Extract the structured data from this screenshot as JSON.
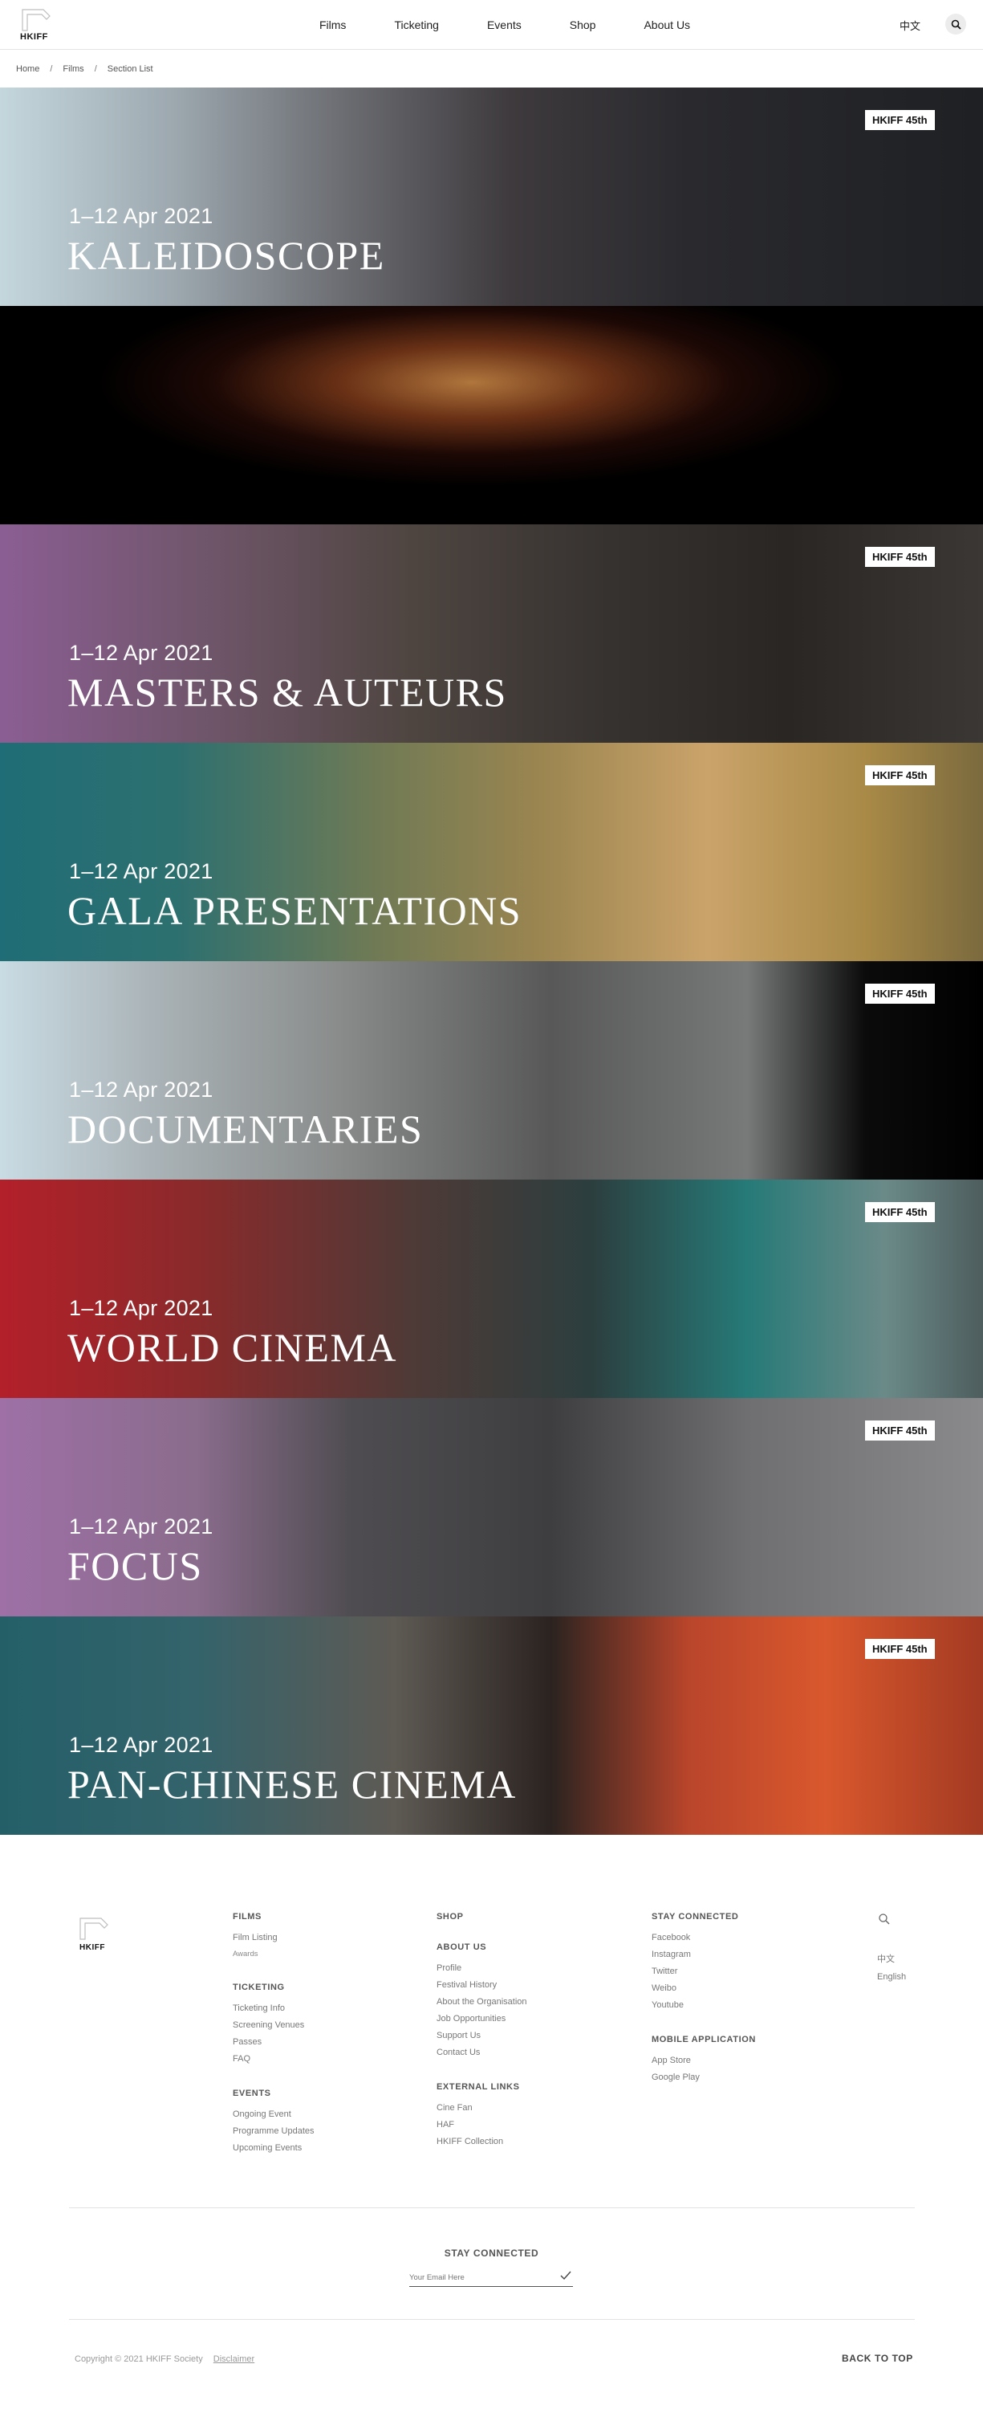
{
  "header": {
    "logo_text": "HKIFF",
    "nav": [
      "Films",
      "Ticketing",
      "Events",
      "Shop",
      "About Us"
    ],
    "lang": "中文"
  },
  "breadcrumb": [
    "Home",
    "Films",
    "Section List"
  ],
  "banners": [
    {
      "date": "1–12 Apr 2021",
      "title": "KALEIDOSCOPE",
      "badge": "HKIFF 45th"
    },
    {
      "date": "",
      "title": "",
      "badge": ""
    },
    {
      "date": "1–12 Apr 2021",
      "title": "MASTERS & AUTEURS",
      "badge": "HKIFF 45th"
    },
    {
      "date": "1–12 Apr 2021",
      "title": "GALA PRESENTATIONS",
      "badge": "HKIFF 45th"
    },
    {
      "date": "1–12 Apr 2021",
      "title": "DOCUMENTARIES",
      "badge": "HKIFF 45th"
    },
    {
      "date": "1–12 Apr 2021",
      "title": "WORLD CINEMA",
      "badge": "HKIFF 45th"
    },
    {
      "date": "1–12 Apr 2021",
      "title": "FOCUS",
      "badge": "HKIFF 45th"
    },
    {
      "date": "1–12 Apr 2021",
      "title": "PAN-CHINESE CINEMA",
      "badge": "HKIFF 45th"
    }
  ],
  "footer": {
    "logo_text": "HKIFF",
    "films": {
      "heading": "FILMS",
      "links": [
        "Film Listing",
        "Awards"
      ]
    },
    "ticketing": {
      "heading": "TICKETING",
      "links": [
        "Ticketing Info",
        "Screening Venues",
        "Passes",
        "FAQ"
      ]
    },
    "events": {
      "heading": "EVENTS",
      "links": [
        "Ongoing Event",
        "Programme Updates",
        "Upcoming Events"
      ]
    },
    "shop": {
      "heading": "SHOP"
    },
    "about": {
      "heading": "ABOUT US",
      "links": [
        "Profile",
        "Festival History",
        "About the Organisation",
        "Job Opportunities",
        "Support Us",
        "Contact Us"
      ]
    },
    "external": {
      "heading": "EXTERNAL LINKS",
      "links": [
        "Cine Fan",
        "HAF",
        "HKIFF Collection"
      ]
    },
    "stay": {
      "heading": "STAY CONNECTED",
      "links": [
        "Facebook",
        "Instagram",
        "Twitter",
        "Weibo",
        "Youtube"
      ]
    },
    "mobile": {
      "heading": "MOBILE APPLICATION",
      "links": [
        "App Store",
        "Google Play"
      ]
    },
    "languages": [
      "中文",
      "English"
    ],
    "newsletter": {
      "heading": "STAY CONNECTED",
      "placeholder": "Your Email Here"
    },
    "copyright": "Copyright © 2021 HKIFF Society",
    "disclaimer": "Disclaimer",
    "back_to_top": "BACK TO TOP"
  }
}
